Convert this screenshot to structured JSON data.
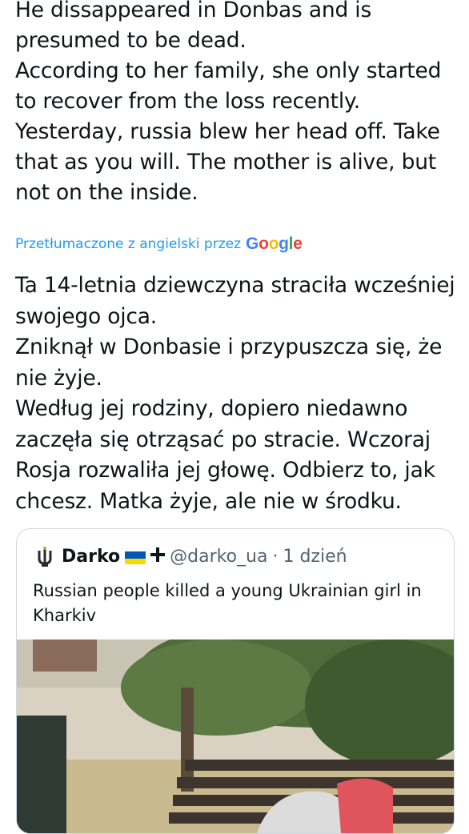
{
  "tweet": {
    "lines": [
      "He dissappeared in Donbas and is presumed to be dead.",
      "According to her family, she only started to recover from the loss recently.",
      "Yesterday, russia blew her head off. Take that as you will. The mother is alive, but not on the inside."
    ]
  },
  "translation_notice": {
    "prefix": "Przetłumaczone z angielski przez",
    "provider": "Google"
  },
  "translation": {
    "lines": [
      "Ta 14-letnia dziewczyna straciła wcześniej swojego ojca.",
      "Zniknął w Donbasie i przypuszcza się, że nie żyje.",
      "Według jej rodziny, dopiero niedawno zaczęła się otrząsać po stracie. Wczoraj Rosja rozwaliła jej głowę. Odbierz to, jak chcesz. Matka żyje, ale nie w środku."
    ]
  },
  "quoted_tweet": {
    "author_name": "Darko",
    "handle": "@darko_ua",
    "separator": "·",
    "time": "1 dzień",
    "text": "Russian people killed a young Ukrainian girl in Kharkiv",
    "badges": [
      "ukraine-flag-icon",
      "cross-icon"
    ]
  },
  "colors": {
    "link": "#1d9bf0",
    "text": "#0f1419",
    "secondary": "#536471",
    "border": "#cfd9de"
  }
}
